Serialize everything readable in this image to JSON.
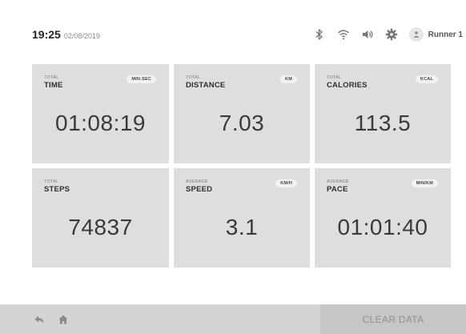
{
  "status": {
    "time": "19:25",
    "date": "02/08/2019",
    "user_name": "Runner 1",
    "icons": [
      "bluetooth-icon",
      "wifi-icon",
      "volume-icon",
      "gear-icon",
      "user-avatar-icon"
    ]
  },
  "cards": [
    {
      "qualifier": "Total",
      "label": "Time",
      "unit": "MIN:SEC",
      "value": "01:08:19"
    },
    {
      "qualifier": "Total",
      "label": "Distance",
      "unit": "KM",
      "value": "7.03"
    },
    {
      "qualifier": "Total",
      "label": "Calories",
      "unit": "KCAL",
      "value": "113.5"
    },
    {
      "qualifier": "Total",
      "label": "Steps",
      "unit": "",
      "value": "74837"
    },
    {
      "qualifier": "Average",
      "label": "Speed",
      "unit": "KM/H",
      "value": "3.1"
    },
    {
      "qualifier": "Average",
      "label": "Pace",
      "unit": "MIN/KM",
      "value": "01:01:40"
    }
  ],
  "bottom_bar": {
    "clear_label": "CLEAR DATA",
    "icons": [
      "back-icon",
      "home-icon"
    ]
  },
  "colors": {
    "card_bg": "#dedede",
    "bottom_bar_bg": "#d4d4d4",
    "clear_button_bg": "#c6c6c6"
  }
}
